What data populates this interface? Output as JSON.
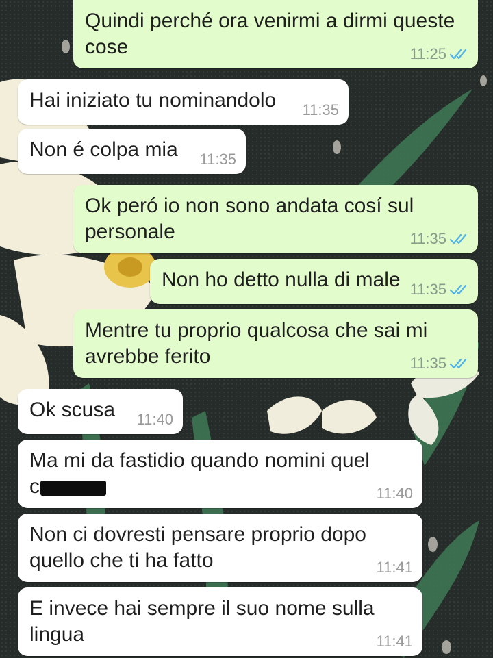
{
  "messages": [
    {
      "dir": "out",
      "text": "Quindi perché ora venirmi a dirmi queste\ncose",
      "time": "11:25",
      "read": true
    },
    {
      "dir": "in",
      "text": "Hai iniziato tu nominandolo",
      "time": "11:35"
    },
    {
      "dir": "in",
      "text": "Non é colpa mia",
      "time": "11:35"
    },
    {
      "dir": "out",
      "text": "Ok peró io non sono andata cosí sul\npersonale",
      "time": "11:35",
      "read": true
    },
    {
      "dir": "out",
      "text": "Non ho detto nulla di male",
      "time": "11:35",
      "read": true
    },
    {
      "dir": "out",
      "text": "Mentre tu proprio qualcosa che sai mi\navrebbe ferito",
      "time": "11:35",
      "read": true
    },
    {
      "dir": "in",
      "text": "Ok scusa",
      "time": "11:40"
    },
    {
      "dir": "in",
      "text": "Ma mi da fastidio quando nomini quel\nc",
      "time": "11:40",
      "redacted": true
    },
    {
      "dir": "in",
      "text": "Non ci dovresti pensare proprio dopo\nquello che ti ha fatto",
      "time": "11:41"
    },
    {
      "dir": "in",
      "text": "E invece hai sempre il suo nome sulla\nlingua",
      "time": "11:41"
    }
  ],
  "colors": {
    "outgoing_bubble": "#e2fccb",
    "incoming_bubble": "#ffffff",
    "read_ticks": "#4fb3e8",
    "wallpaper_dark": "#242a27",
    "wallpaper_flower": "#f3efdc"
  },
  "icons": {
    "read_receipt": "double-check-icon",
    "redaction": "redaction-mark"
  }
}
